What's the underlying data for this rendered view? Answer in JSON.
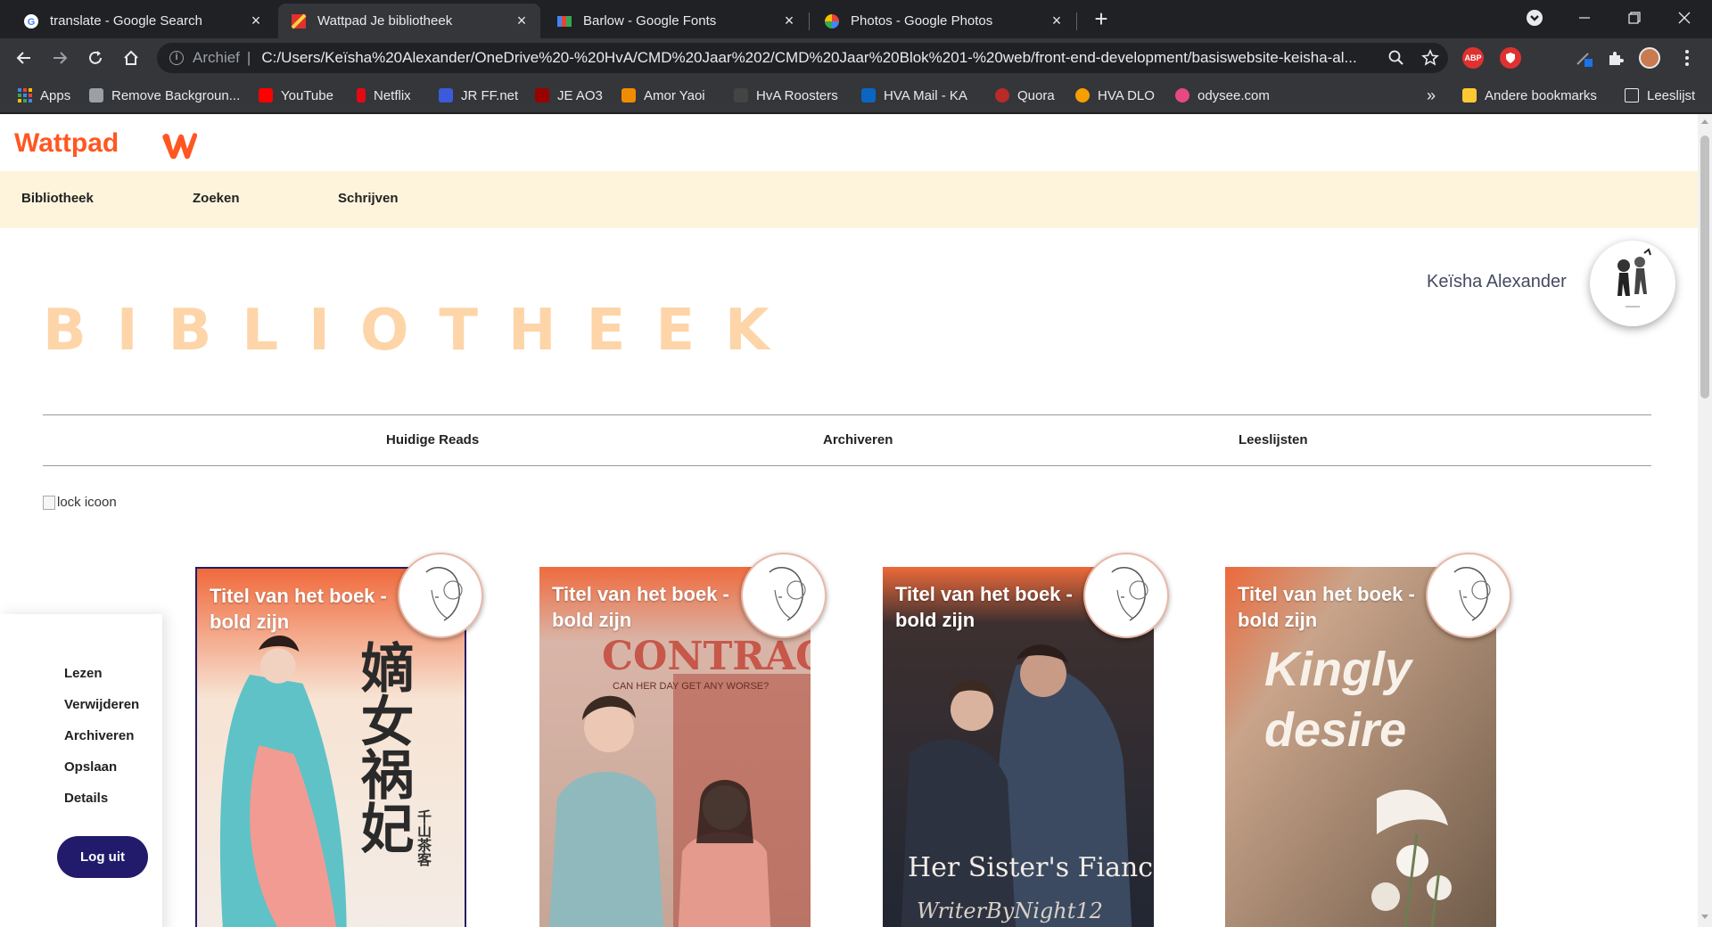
{
  "browser": {
    "tabs": [
      {
        "title": "translate - Google Search",
        "active": false
      },
      {
        "title": "Wattpad Je bibliotheek",
        "active": true
      },
      {
        "title": "Barlow - Google Fonts",
        "active": false
      },
      {
        "title": "Photos - Google Photos",
        "active": false
      }
    ],
    "address": {
      "scheme": "Archief",
      "divider": "|",
      "url": "C:/Users/Keïsha%20Alexander/OneDrive%20-%20HvA/CMD%20Jaar%202/CMD%20Jaar%20Blok%201-%20web/front-end-development/basiswebsite-keisha-al..."
    },
    "extensions": {
      "abp": "ABP"
    },
    "bookmarks": [
      {
        "label": "Apps",
        "color": "#4285f4"
      },
      {
        "label": "Remove Backgroun...",
        "color": "#9aa0a6"
      },
      {
        "label": "YouTube",
        "color": "#ff0000"
      },
      {
        "label": "Netflix",
        "color": "#e50914"
      },
      {
        "label": "JR FF.net",
        "color": "#3b5bdb"
      },
      {
        "label": "JE AO3",
        "color": "#990000"
      },
      {
        "label": "Amor Yaoi",
        "color": "#f08c00"
      },
      {
        "label": "HvA Roosters",
        "color": "#444444"
      },
      {
        "label": "HVA Mail - KA",
        "color": "#0a66c2"
      },
      {
        "label": "Quora",
        "color": "#b92b27"
      },
      {
        "label": "HVA DLO",
        "color": "#f59f00"
      },
      {
        "label": "odysee.com",
        "color": "#e64980"
      }
    ],
    "bookmarks_overflow": "»",
    "other_bookmarks": "Andere bookmarks",
    "reading_list": "Leeslijst"
  },
  "page": {
    "brand": "Wattpad",
    "brand_color": "#ff5722",
    "nav": [
      "Bibliotheek",
      "Zoeken",
      "Schrijven"
    ],
    "profile_name": "Keïsha Alexander",
    "title": "BIBLIOTHEEK",
    "library_tabs": [
      "Huidige Reads",
      "Archiveren",
      "Leeslijsten"
    ],
    "lock_alt": "lock icoon",
    "side_menu": [
      "Lezen",
      "Verwijderen",
      "Archiveren",
      "Opslaan",
      "Details"
    ],
    "logout": "Log uit",
    "books": [
      {
        "title_line1": "Titel van het boek -",
        "title_line2": "bold zijn",
        "cover_text": "嫡女祸妃",
        "cover_sub": "千山茶客"
      },
      {
        "title_line1": "Titel van het boek -",
        "title_line2": "bold zijn",
        "cover_text": "CONTRACT",
        "cover_sub": "CAN HER DAY GET ANY WORSE?"
      },
      {
        "title_line1": "Titel van het boek -",
        "title_line2": "bold zijn",
        "cover_text": "Her Sister's Fiancé",
        "cover_sub": "WriterByNight12"
      },
      {
        "title_line1": "Titel van het boek -",
        "title_line2": "bold zijn",
        "cover_text": "Kingly",
        "cover_sub": "desire"
      }
    ]
  }
}
